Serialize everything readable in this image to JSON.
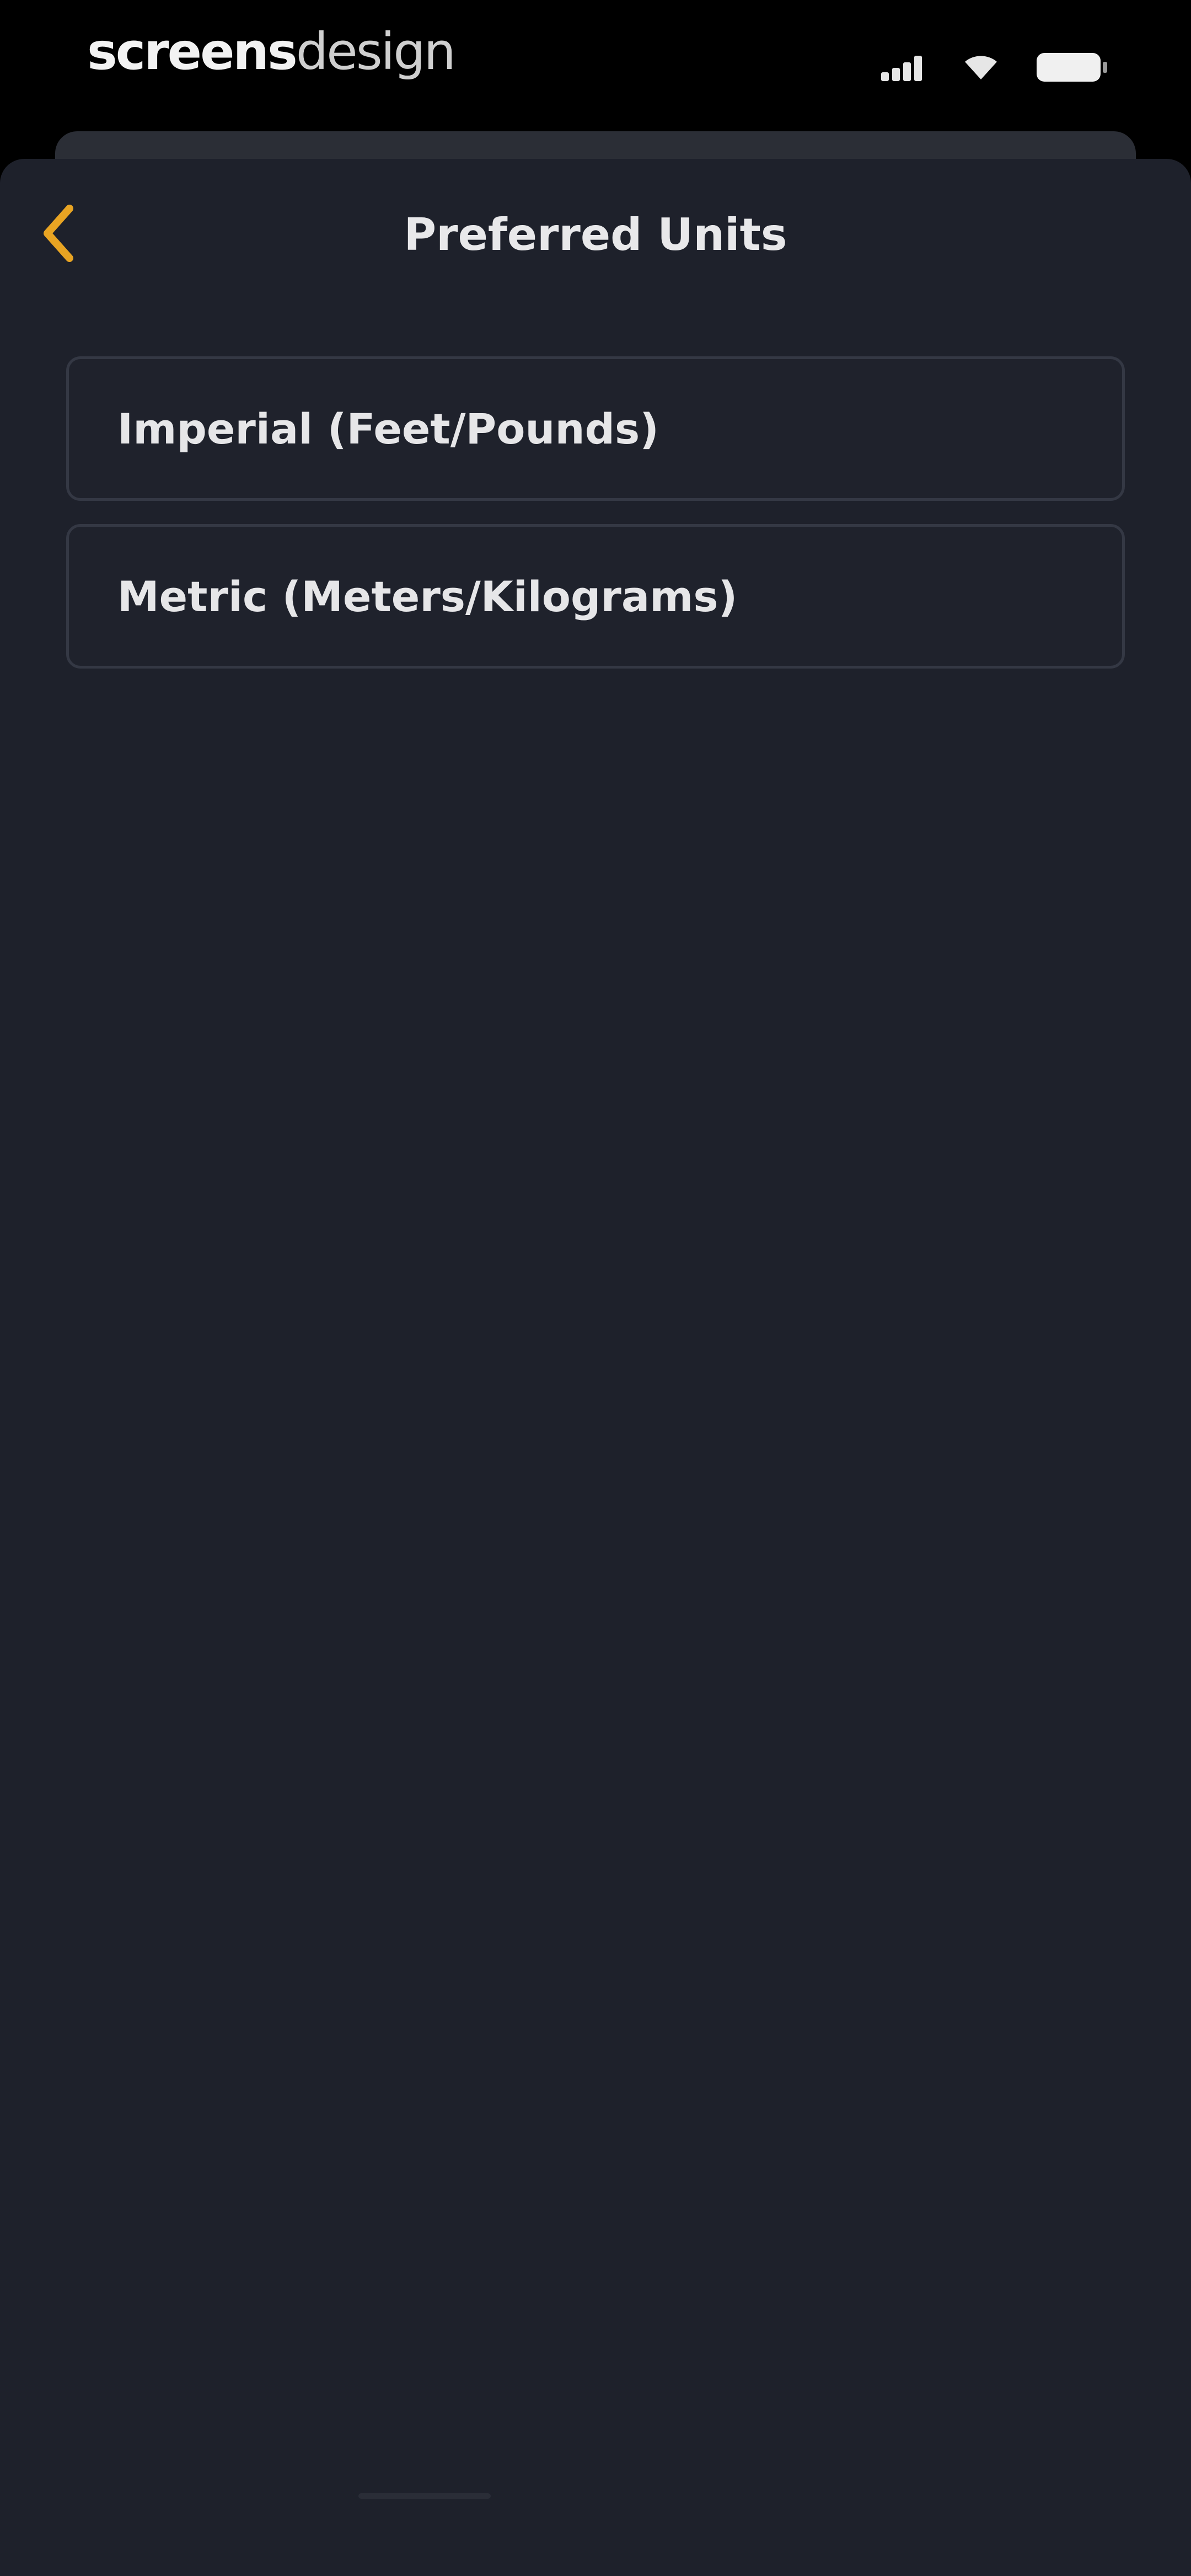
{
  "status_bar": {
    "brand_strong": "screens",
    "brand_light": "design",
    "icons": [
      "signal-icon",
      "wifi-icon",
      "battery-icon"
    ]
  },
  "nav": {
    "title": "Preferred Units",
    "back_icon": "chevron-left-icon"
  },
  "options": [
    {
      "label": "Imperial (Feet/Pounds)"
    },
    {
      "label": "Metric (Meters/Kilograms)"
    }
  ],
  "colors": {
    "accent": "#e8a423",
    "background": "#1e212b",
    "option_border": "#343844",
    "text": "#e6e6e8"
  }
}
